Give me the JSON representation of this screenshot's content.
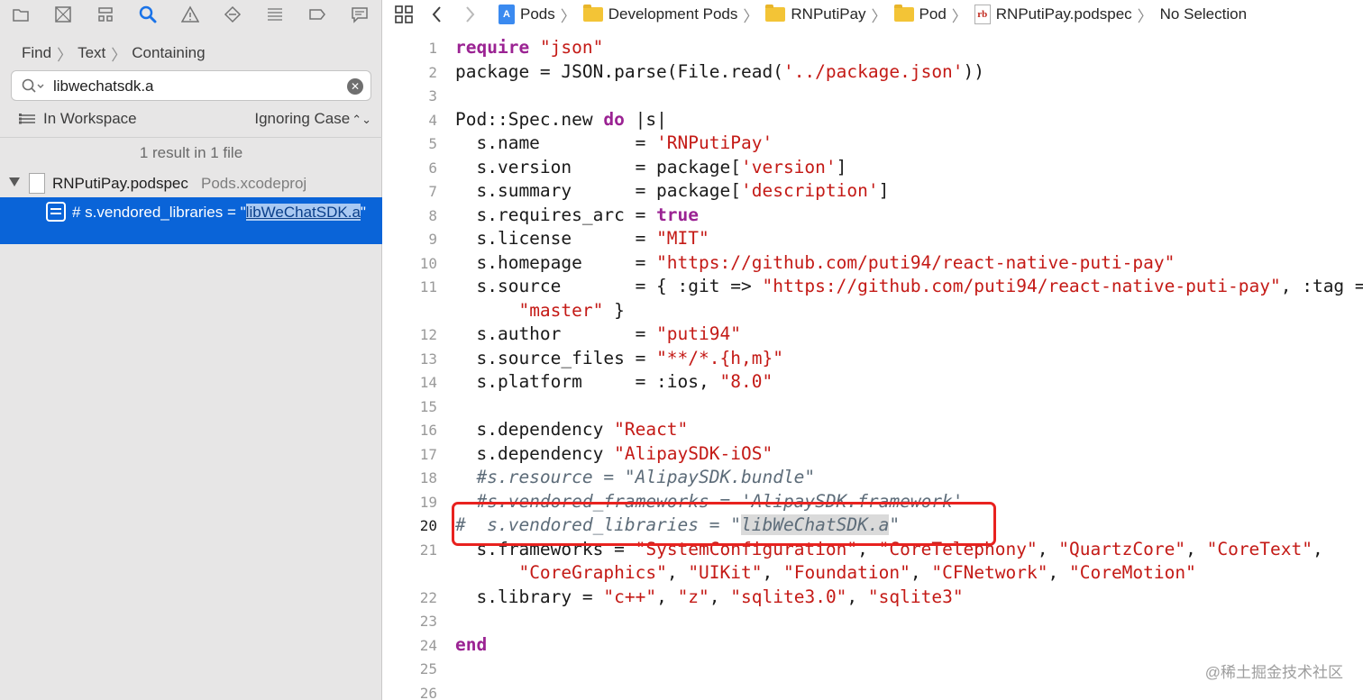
{
  "navigator": {
    "toolbar_icons": [
      "folder-icon",
      "source-control-icon",
      "symbol-navigator-icon",
      "search-icon",
      "warning-icon",
      "test-diamond-icon",
      "debug-list-icon",
      "breakpoint-tag-icon",
      "report-message-icon"
    ],
    "find_bar": {
      "mode": "Find",
      "kind": "Text",
      "match": "Containing"
    },
    "search": {
      "value": "libwechatsdk.a"
    },
    "scope": {
      "label": "In Workspace",
      "case": "Ignoring Case"
    },
    "result_count": "1 result in 1 file",
    "file": {
      "name": "RNPutiPay.podspec",
      "project": "Pods.xcodeproj"
    },
    "match": {
      "prefix": "#  s.vendored_libraries = \"",
      "highlight": "libWeChatSDK.a",
      "suffix": "\""
    }
  },
  "jump_bar": {
    "crumbs": [
      "Pods",
      "Development Pods",
      "RNPutiPay",
      "Pod",
      "RNPutiPay.podspec",
      "No Selection"
    ],
    "chevron": "〉"
  },
  "code": {
    "current_line": 20,
    "lines": [
      {
        "n": "1"
      },
      {
        "n": "2"
      },
      {
        "n": "3"
      },
      {
        "n": "4"
      },
      {
        "n": "5"
      },
      {
        "n": "6"
      },
      {
        "n": "7"
      },
      {
        "n": "8"
      },
      {
        "n": "9"
      },
      {
        "n": "10"
      },
      {
        "n": "11"
      },
      {
        "n": ""
      },
      {
        "n": "12"
      },
      {
        "n": "13"
      },
      {
        "n": "14"
      },
      {
        "n": "15"
      },
      {
        "n": "16"
      },
      {
        "n": "17"
      },
      {
        "n": "18"
      },
      {
        "n": "19"
      },
      {
        "n": "20"
      },
      {
        "n": "21"
      },
      {
        "n": ""
      },
      {
        "n": "22"
      },
      {
        "n": "23"
      },
      {
        "n": "24"
      },
      {
        "n": "25"
      },
      {
        "n": "26"
      }
    ]
  },
  "watermark": "@稀土掘金技术社区",
  "colors": {
    "keyword": "#9b2393",
    "string": "#c41a16",
    "comment": "#5d6c79",
    "selection": "#0a64d8",
    "annotation_box": "#e8221f"
  }
}
